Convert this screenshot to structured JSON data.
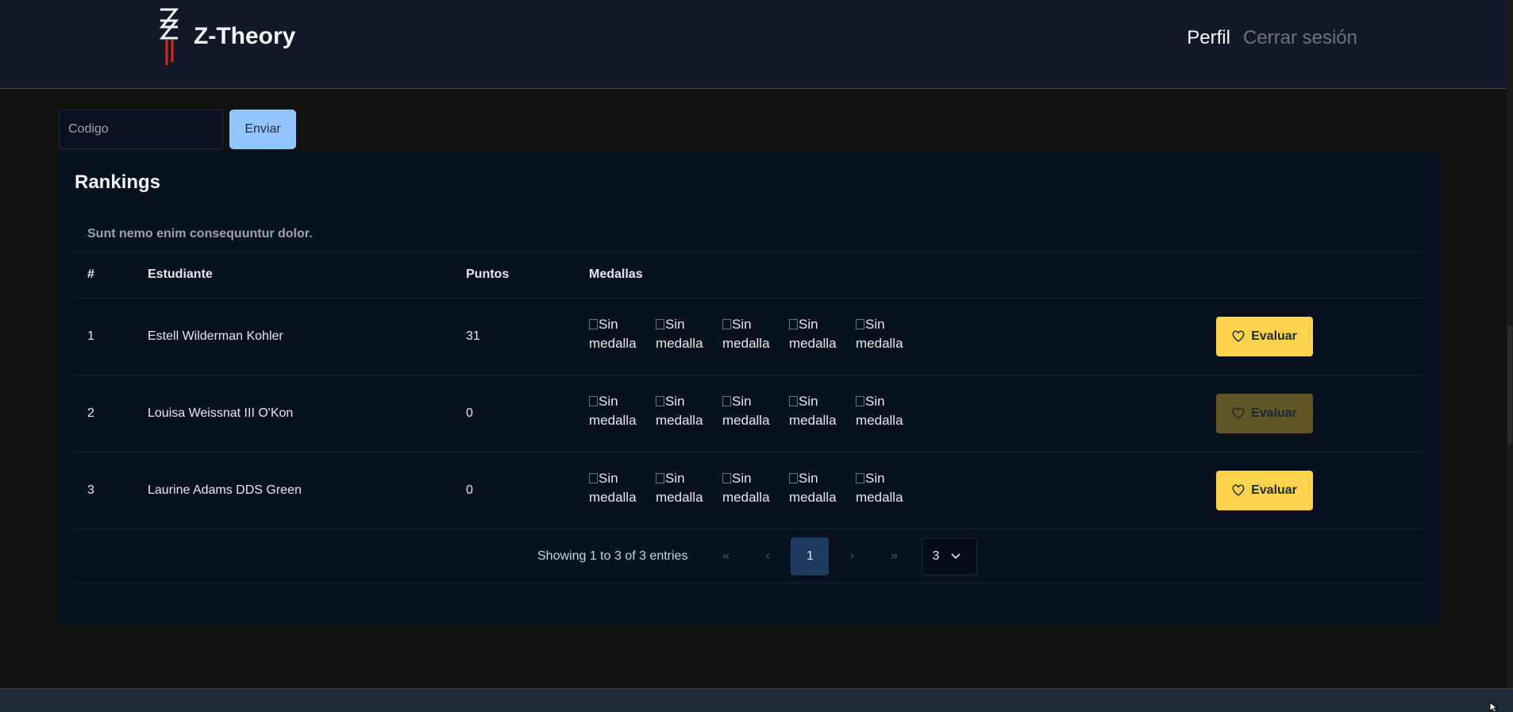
{
  "header": {
    "brand": "Z-Theory",
    "nav": {
      "profile": "Perfil",
      "logout": "Cerrar sesión"
    }
  },
  "code_form": {
    "placeholder": "Codigo",
    "submit_label": "Enviar"
  },
  "rankings": {
    "title": "Rankings",
    "caption": "Sunt nemo enim consequuntur dolor.",
    "columns": {
      "rank": "#",
      "student": "Estudiante",
      "points": "Puntos",
      "medals": "Medallas"
    },
    "medal_alt": [
      "Sin",
      "medalla"
    ],
    "evaluate_label": "Evaluar",
    "rows": [
      {
        "rank": "1",
        "student": "Estell Wilderman Kohler",
        "points": "31",
        "evaluate_enabled": true
      },
      {
        "rank": "2",
        "student": "Louisa Weissnat III O'Kon",
        "points": "0",
        "evaluate_enabled": false
      },
      {
        "rank": "3",
        "student": "Laurine Adams DDS Green",
        "points": "0",
        "evaluate_enabled": true
      }
    ],
    "pagination": {
      "info": "Showing 1 to 3 of 3 entries",
      "first": "«",
      "prev": "‹",
      "current": "1",
      "next": "›",
      "last": "»",
      "page_size": "3"
    }
  },
  "colors": {
    "accent_button": "#93c5fd",
    "evaluate_button": "#fcd34d",
    "card_bg": "#08121f",
    "navbar_bg": "#111827"
  }
}
